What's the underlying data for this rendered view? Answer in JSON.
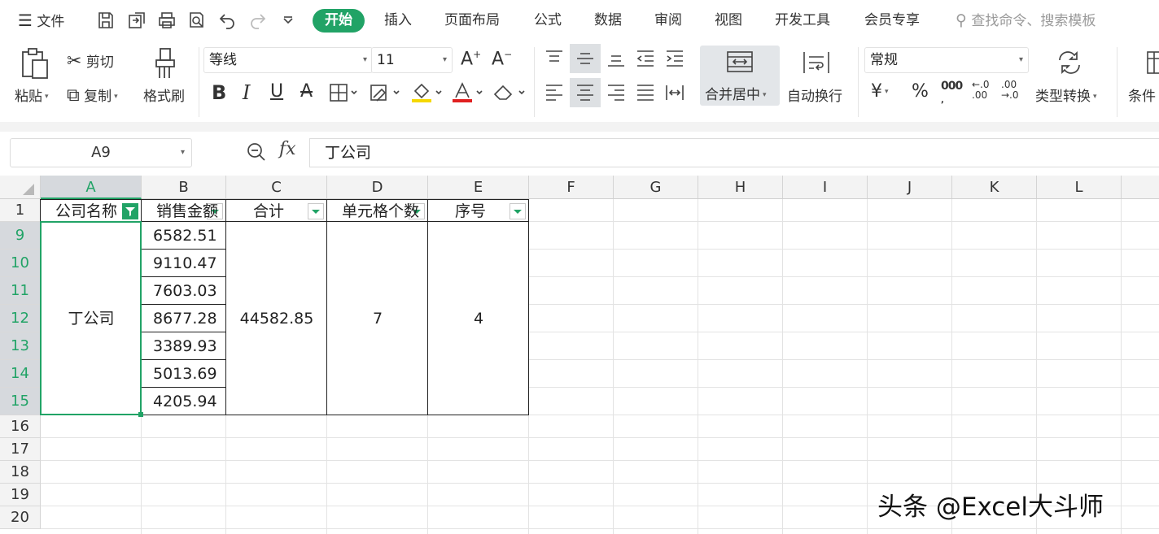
{
  "menubar": {
    "file": "文件",
    "tabs": [
      "开始",
      "插入",
      "页面布局",
      "公式",
      "数据",
      "审阅",
      "视图",
      "开发工具",
      "会员专享"
    ],
    "search_placeholder": "查找命令、搜索模板"
  },
  "ribbon": {
    "paste": "粘贴",
    "cut": "剪切",
    "copy": "复制",
    "format_painter": "格式刷",
    "font_name": "等线",
    "font_size": "11",
    "merge_center": "合并居中",
    "wrap_text": "自动换行",
    "number_format": "常规",
    "type_convert": "类型转换",
    "conditional": "条件"
  },
  "formula_bar": {
    "name_box": "A9",
    "fx": "fx",
    "content": "丁公司"
  },
  "grid": {
    "columns": [
      "A",
      "B",
      "C",
      "D",
      "E",
      "F",
      "G",
      "H",
      "I",
      "J",
      "K",
      "L"
    ],
    "selected_column": "A",
    "rows": [
      "1",
      "9",
      "10",
      "11",
      "12",
      "13",
      "14",
      "15",
      "16",
      "17",
      "18",
      "19",
      "20"
    ],
    "selected_rows": [
      "9",
      "10",
      "11",
      "12",
      "13",
      "14",
      "15"
    ],
    "headers": [
      "公司名称",
      "销售金额",
      "合计",
      "单元格个数",
      "序号"
    ],
    "company": "丁公司",
    "sales": [
      "6582.51",
      "9110.47",
      "7603.03",
      "8677.28",
      "3389.93",
      "5013.69",
      "4205.94"
    ],
    "total": "44582.85",
    "cell_count": "7",
    "index": "4"
  },
  "watermark": "头条 @Excel大斗师",
  "colors": {
    "accent": "#21a366",
    "header_bg": "#f3f3f3",
    "selected_header_bg": "#d6d9dd"
  }
}
